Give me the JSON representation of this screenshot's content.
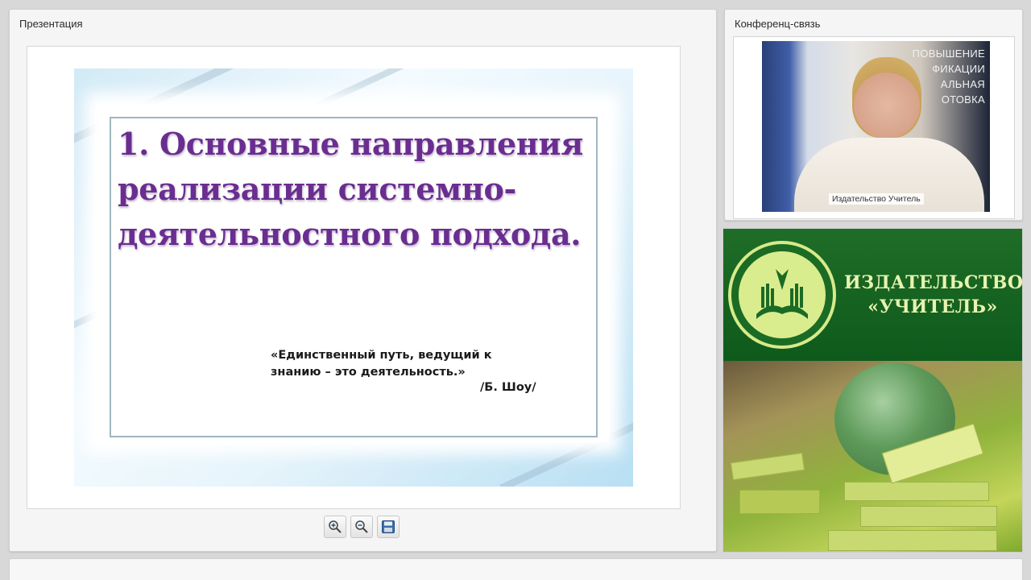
{
  "presentation": {
    "title": "Презентация",
    "slide": {
      "heading": "1. Основные направления реализации системно-деятельностного подхода.",
      "quote": "«Единственный путь, ведущий к знанию – это деятельность.»",
      "quote_author": "/Б. Шоу/",
      "heading_color": "#6a2d90"
    },
    "toolbar": {
      "zoom_in": "zoom-in-icon",
      "zoom_out": "zoom-out-icon",
      "save": "save-icon"
    }
  },
  "conference": {
    "title": "Конференц-связь",
    "video_caption": "Издательство Учитель",
    "poster_text": "ПОВЫШЕНИЕ\nФИКАЦИИ\nАЛЬНАЯ\nОТОВКА"
  },
  "banner": {
    "title_line1": "ИЗДАТЕЛЬСТВО",
    "title_line2": "«УЧИТЕЛЬ»",
    "brand_color": "#0e5a1c"
  }
}
